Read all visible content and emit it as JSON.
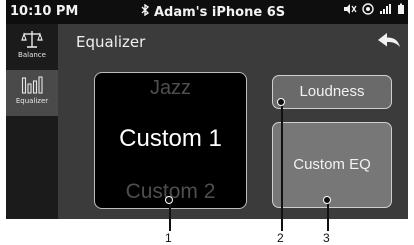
{
  "status_bar": {
    "time": "10:10 PM",
    "device_name": "Adam's iPhone 6S",
    "icons": [
      "bluetooth-icon",
      "mute-icon",
      "gps-icon",
      "signal-icon",
      "battery-icon"
    ]
  },
  "sidebar": {
    "items": [
      {
        "label": "Balance",
        "icon": "balance-scale-icon",
        "active": false
      },
      {
        "label": "Equalizer",
        "icon": "equalizer-icon",
        "active": true
      }
    ]
  },
  "header": {
    "title": "Equalizer",
    "back_icon": "back-arrow-icon"
  },
  "preset_picker": {
    "previous": "Jazz",
    "current": "Custom 1",
    "next": "Custom 2"
  },
  "buttons": {
    "loudness": "Loudness",
    "custom_eq": "Custom EQ"
  },
  "callouts": [
    "1",
    "2",
    "3"
  ],
  "colors": {
    "status_bar_bg": "#0e0e0e",
    "screen_bg": "#3b3b3b",
    "sidebar_bg": "#1b1b1b",
    "sidebar_active_bg": "#4a4a4a",
    "picker_bg": "#000000",
    "button_bg": "#6a6a6a"
  }
}
